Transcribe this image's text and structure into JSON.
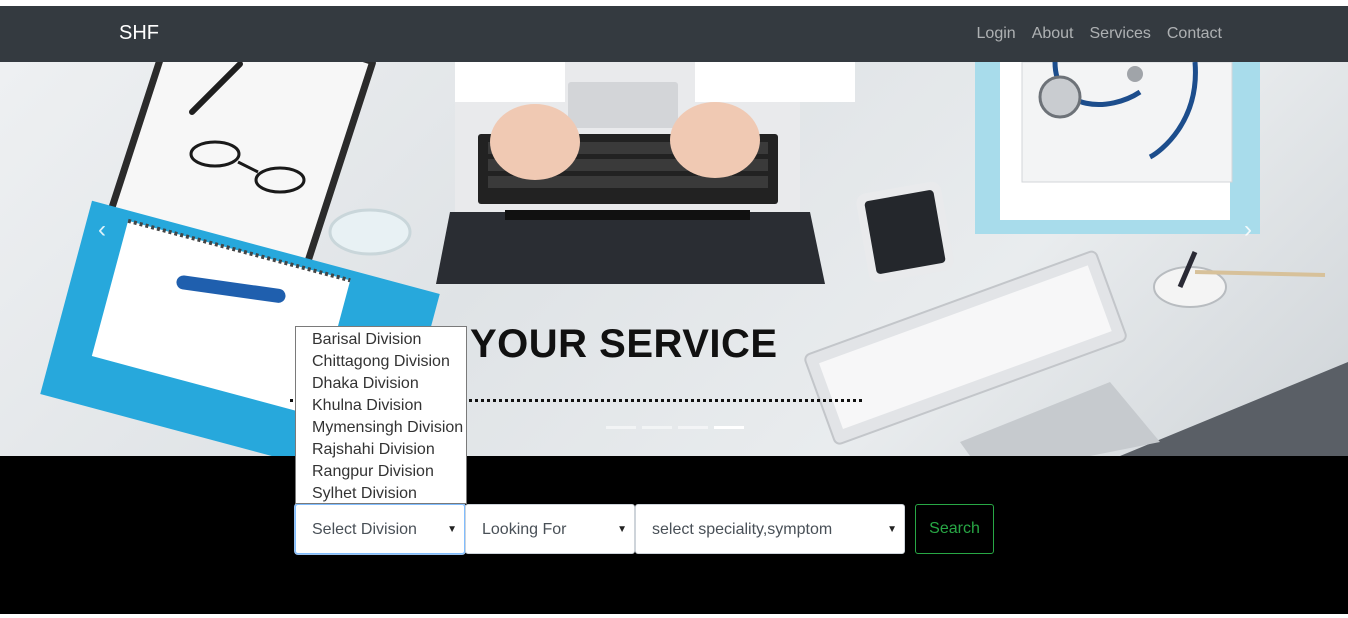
{
  "navbar": {
    "brand": "SHF",
    "links": [
      "Login",
      "About",
      "Services",
      "Contact"
    ]
  },
  "hero": {
    "title": "YOUR SERVICE",
    "carousel_prev_icon": "chevron-left-icon",
    "carousel_next_icon": "chevron-right-icon",
    "slides_count": 4,
    "active_slide": 4
  },
  "search": {
    "division": {
      "selected": "Select Division",
      "options": [
        "Barisal Division",
        "Chittagong Division",
        "Dhaka Division",
        "Khulna Division",
        "Mymensingh Division",
        "Rajshahi Division",
        "Rangpur Division",
        "Sylhet Division"
      ]
    },
    "looking_for": {
      "selected": "Looking For"
    },
    "speciality": {
      "selected": "select speciality,symptom"
    },
    "button_label": "Search"
  },
  "colors": {
    "navbar_bg": "#343a40",
    "band_bg": "#000000",
    "search_button": "#28a745"
  }
}
